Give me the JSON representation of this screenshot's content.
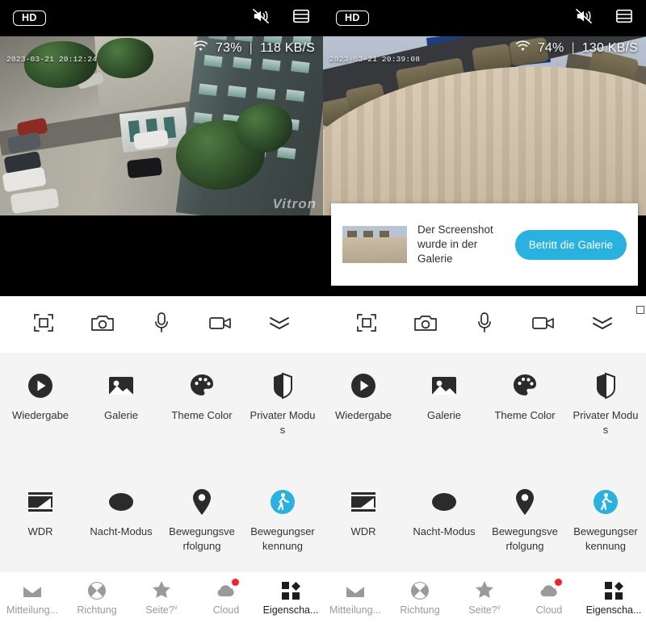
{
  "panes": [
    {
      "quality_badge": "HD",
      "mute_icon": "speaker-muted-icon",
      "layout_icon": "split-layout-icon",
      "signal_icon": "wifi-icon",
      "signal_percent": "73%",
      "separator": "|",
      "bitrate": "118 KB/S",
      "timestamp": "2023-03-21 20:12:24",
      "watermark": "Vitron",
      "scene": "parking-lot-aerial"
    },
    {
      "quality_badge": "HD",
      "mute_icon": "speaker-muted-icon",
      "layout_icon": "split-layout-icon",
      "signal_icon": "wifi-icon",
      "signal_percent": "74%",
      "separator": "|",
      "bitrate": "130 KB/S",
      "timestamp": "2023-03-21 20:39:08",
      "watermark": "",
      "scene": "conference-room"
    }
  ],
  "toast": {
    "message": "Der Screenshot wurde in der Galerie",
    "button_label": "Betritt die Galerie",
    "accent_color": "#29b1e0",
    "thumbnail_alt": "screenshot-thumbnail"
  },
  "controls": [
    {
      "icon": "fullscreen-icon",
      "name": "fullscreen-button"
    },
    {
      "icon": "camera-icon",
      "name": "snapshot-button"
    },
    {
      "icon": "microphone-icon",
      "name": "talk-button"
    },
    {
      "icon": "video-camera-icon",
      "name": "record-button"
    },
    {
      "icon": "double-chevron-down-icon",
      "name": "collapse-button"
    }
  ],
  "features_row1": [
    {
      "label": "Wiedergabe",
      "icon": "play-circle-icon",
      "active": false
    },
    {
      "label": "Galerie",
      "icon": "photo-icon",
      "active": false
    },
    {
      "label": "Theme Color",
      "icon": "palette-icon",
      "active": false
    },
    {
      "label": "Privater Modus",
      "icon": "privacy-shield-icon",
      "active": false
    }
  ],
  "features_row2": [
    {
      "label": "WDR",
      "icon": "wdr-icon",
      "active": false
    },
    {
      "label": "Nacht-Modus",
      "icon": "moon-icon",
      "active": false
    },
    {
      "label": "Bewegungsverfolgung",
      "icon": "location-pin-icon",
      "active": false
    },
    {
      "label": "Bewegungserkennung",
      "icon": "walking-person-icon",
      "active": true
    }
  ],
  "colors": {
    "accent": "#29b1e0",
    "panel_bg": "#f4f4f4",
    "nav_inactive": "#9a9a9a",
    "nav_active": "#1d1d1d",
    "badge": "#f5222d"
  },
  "bottom_nav": [
    {
      "label": "Mitteilung...",
      "icon": "mail-icon",
      "active": false,
      "badge": false
    },
    {
      "label": "Richtung",
      "icon": "compass-icon",
      "active": false,
      "badge": false
    },
    {
      "label": "Seite?",
      "icon": "star-icon",
      "active": false,
      "badge": false,
      "caret": "v"
    },
    {
      "label": "Cloud",
      "icon": "cloud-icon",
      "active": false,
      "badge": true
    },
    {
      "label": "Eigenscha...",
      "icon": "grid-apps-icon",
      "active": true,
      "badge": false
    }
  ]
}
